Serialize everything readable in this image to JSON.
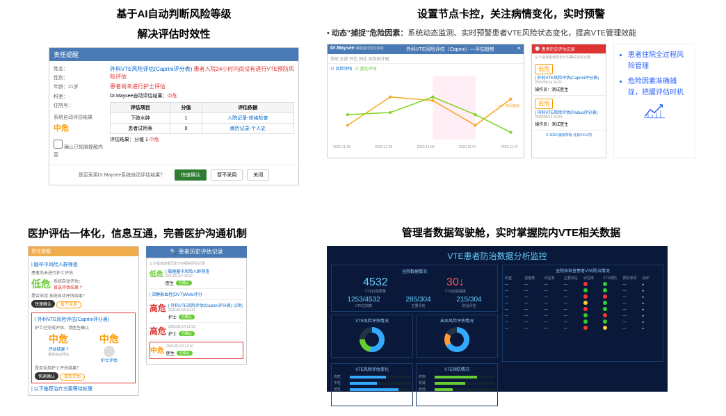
{
  "s1": {
    "heading_l1": "基于AI自动判断风险等级",
    "heading_l2": "解决评估时效性",
    "dialog": {
      "title": "责任提醒",
      "fields": {
        "name_lbl": "姓名：",
        "gender_lbl": "性别：",
        "age_lbl": "年龄：",
        "age_val": "21岁",
        "dept_lbl": "科室：",
        "bed_lbl": "住院号：",
        "status_lbl": "系统自动评估结果",
        "risk_badge": "中危",
        "checkbox": "确认已知晓提醒内容"
      },
      "warn1_a": "外科VTE风险评估(Caprini评分表)",
      "warn1_b": "患者入院24小时内尚没有进行VTE预防风险评估",
      "warn2": "患者尚未进行护士评估",
      "result_prefix": "Dr.Maysee自动评估结果：",
      "result_risk": "中危",
      "table": {
        "h1": "评估项目",
        "h2": "分值",
        "h3": "评估依据",
        "r1c1": "下肢水肿",
        "r1c2": "1",
        "r1c3": "入院记录-体格检查",
        "r1c4": "患者试用表",
        "r1c5": "0",
        "r1c6": "病历记录-个人史",
        "sum_lbl": "评估结果：分值",
        "sum_val": "1",
        "sum_risk": "中危"
      },
      "footer_q": "是否采用Dr.Maysee系统自动评估结果？",
      "btn_confirm": "快速确认",
      "btn_skip": "暂不采用",
      "btn_close": "关闭"
    }
  },
  "s2": {
    "heading": "设置节点卡控，关注病情变化，实时预警",
    "bullet_b": "动态\"捕捉\"危险因素：",
    "bullet": "系统动态监测、实时预警患者VTE风险状态变化，提高VTE管理效能",
    "chart": {
      "brand": "Dr.Maysee",
      "brand_sub": "静脉血栓防控系统",
      "title": "外科VTE风险评估（Caprini）—评估趋势",
      "tabs": "单项 全部 环比 同比 风险统计图",
      "tab1": "⊙ 风险评估",
      "tab2": "⊙ 量化评估",
      "legend": "—●— 日间病房",
      "xaxis": [
        "2020-11-05",
        "2020-11-06",
        "2020-11-06",
        "2020-11-07",
        "2020-11-07"
      ]
    },
    "hist": {
      "title": "患者历史评估记录",
      "note": "以下是该患者历史VTE相关评估记录",
      "items": [
        {
          "risk": "低危",
          "label": "| 外科VTE风险评估(Caprini评分表)",
          "date": "2020/09/14 15:21",
          "role": "操作员：测试医生"
        },
        {
          "risk": "低危",
          "label": "| 内科VTE风险评估(Padua评分表)",
          "date": "2020/09/14 15:20",
          "role": "操作员：测试医生"
        }
      ],
      "footer": "© 2020 版权所有  北京XX公司"
    },
    "info": {
      "i1": "患者住院全过程风险管理",
      "i2": "危险因素准确捕捉，把握评估时机"
    }
  },
  "s3": {
    "heading": "医护评估一体化，信息互通，完善医护沟通机制",
    "pa": {
      "hdr": "责任提醒",
      "sec1_title": "| 脑卒中风险人群筛查",
      "sec1_txt": "患者尚未进行护士评估",
      "sec1_sys": "系统自动评估：",
      "sec1_risk": "低危",
      "sec1_first": "首选评估结果 ?",
      "sec1_q": "是否采用 系统自动评估结果？",
      "btn_fast": "快速确认",
      "btn_no": "暂不采用",
      "sec2_title": "| 外科VTE风险评估(Caprini评分表)",
      "sec2_txt": "护士已完成评估，请医生确认",
      "mid1": "中危",
      "mid2": "中危",
      "link1": "评估结果 ?",
      "link2": "护士评估",
      "avatar_lbl": "系统自动评估",
      "sec2_q": "是否采用护士评估结果？",
      "btn_redo": "重新评估",
      "sec3_title": "| 以下推荐治疗方案等待处理"
    },
    "pb": {
      "hdr": "患者历史评估记录",
      "note": "以下是该患者历史VTE相关评估记录",
      "items": [
        {
          "risk": "低危",
          "label": "| 脑梗塞中风险人群筛查",
          "date": "2021/01/17 09:22",
          "role": "医生",
          "done": "已确认"
        },
        {
          "risk": "",
          "label": "| 深静脉血栓(DVT)Wells评分",
          "date": "2021/01/18 10:31",
          "role": "护士",
          "done": "已确认",
          "sub": [
            {
              "date": "2021/01/14 12:53",
              "role": "医生",
              "done": "已确认"
            }
          ]
        },
        {
          "risk": "高危",
          "label": "| 外科VTE风险评估(Caprini评分表) (2项)",
          "date": "2021/01/18 10:31",
          "role": "护士",
          "done": "已确认"
        },
        {
          "risk": "高危",
          "label": "",
          "date": "2021/01/14 12:53",
          "role": "护士",
          "done": "已确认"
        },
        {
          "risk": "中危",
          "label": "",
          "date": "2021/01/13 12:10",
          "role": "医生",
          "done": "已确认",
          "boxed": true
        }
      ]
    }
  },
  "s4": {
    "heading": "管理者数据驾驶舱，实时掌握院内VTE相关数据",
    "dash": {
      "title": "VTE患者防治数据分析监控",
      "card1_hdr": "全院数据情况",
      "big1": "4532",
      "big1_sub": "VTE住院质量",
      "big2": "30↓",
      "big2_sub": "VTE住院漏报",
      "stat1_n": "1253/4532",
      "stat1_l": "VTE住院数",
      "stat2_n": "285/304",
      "stat2_l": "主要评估",
      "stat3_n": "215/304",
      "stat3_l": "防治评估",
      "pie1_hdr": "VTE风险评估情况",
      "pie2_hdr": "出血风险评估情况",
      "bar1_hdr": "VTE风险评估变化",
      "bar2_hdr": "VTE预防情况",
      "table_hdr": "全院各科室患者VTE防治情况",
      "th": [
        "科室",
        "患者数",
        "评估率",
        "主要评估",
        "评估率",
        "VTE预防",
        "预防事项",
        "操作"
      ]
    }
  },
  "chart_data": {
    "type": "line",
    "title": "外科VTE风险评估（Caprini）—评估趋势",
    "x": [
      "2020-11-05",
      "2020-11-06",
      "2020-11-06",
      "2020-11-07",
      "2020-11-07"
    ],
    "series": [
      {
        "name": "风险评估",
        "values": [
          2,
          4.5,
          4.2,
          2,
          4.3
        ],
        "color": "#f5a623"
      },
      {
        "name": "量化评估",
        "values": [
          3,
          3.2,
          4.5,
          3,
          1.5
        ],
        "color": "#7ed321"
      }
    ],
    "ylim": [
      0,
      6
    ],
    "legend": "日间病房"
  }
}
